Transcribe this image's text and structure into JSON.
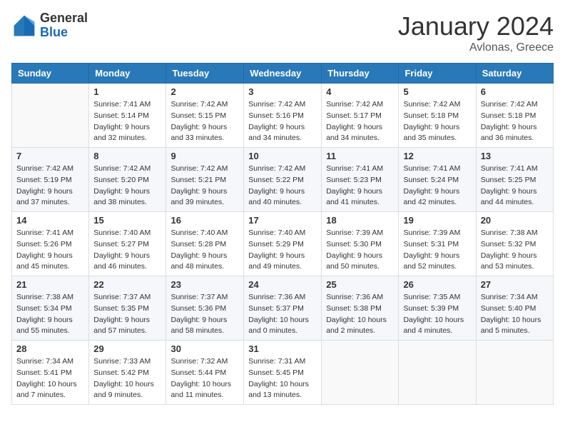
{
  "logo": {
    "general": "General",
    "blue": "Blue"
  },
  "title": "January 2024",
  "location": "Avlonas, Greece",
  "days_header": [
    "Sunday",
    "Monday",
    "Tuesday",
    "Wednesday",
    "Thursday",
    "Friday",
    "Saturday"
  ],
  "weeks": [
    [
      {
        "day": "",
        "sunrise": "",
        "sunset": "",
        "daylight": ""
      },
      {
        "day": "1",
        "sunrise": "Sunrise: 7:41 AM",
        "sunset": "Sunset: 5:14 PM",
        "daylight": "Daylight: 9 hours and 32 minutes."
      },
      {
        "day": "2",
        "sunrise": "Sunrise: 7:42 AM",
        "sunset": "Sunset: 5:15 PM",
        "daylight": "Daylight: 9 hours and 33 minutes."
      },
      {
        "day": "3",
        "sunrise": "Sunrise: 7:42 AM",
        "sunset": "Sunset: 5:16 PM",
        "daylight": "Daylight: 9 hours and 34 minutes."
      },
      {
        "day": "4",
        "sunrise": "Sunrise: 7:42 AM",
        "sunset": "Sunset: 5:17 PM",
        "daylight": "Daylight: 9 hours and 34 minutes."
      },
      {
        "day": "5",
        "sunrise": "Sunrise: 7:42 AM",
        "sunset": "Sunset: 5:18 PM",
        "daylight": "Daylight: 9 hours and 35 minutes."
      },
      {
        "day": "6",
        "sunrise": "Sunrise: 7:42 AM",
        "sunset": "Sunset: 5:18 PM",
        "daylight": "Daylight: 9 hours and 36 minutes."
      }
    ],
    [
      {
        "day": "7",
        "sunrise": "Sunrise: 7:42 AM",
        "sunset": "Sunset: 5:19 PM",
        "daylight": "Daylight: 9 hours and 37 minutes."
      },
      {
        "day": "8",
        "sunrise": "Sunrise: 7:42 AM",
        "sunset": "Sunset: 5:20 PM",
        "daylight": "Daylight: 9 hours and 38 minutes."
      },
      {
        "day": "9",
        "sunrise": "Sunrise: 7:42 AM",
        "sunset": "Sunset: 5:21 PM",
        "daylight": "Daylight: 9 hours and 39 minutes."
      },
      {
        "day": "10",
        "sunrise": "Sunrise: 7:42 AM",
        "sunset": "Sunset: 5:22 PM",
        "daylight": "Daylight: 9 hours and 40 minutes."
      },
      {
        "day": "11",
        "sunrise": "Sunrise: 7:41 AM",
        "sunset": "Sunset: 5:23 PM",
        "daylight": "Daylight: 9 hours and 41 minutes."
      },
      {
        "day": "12",
        "sunrise": "Sunrise: 7:41 AM",
        "sunset": "Sunset: 5:24 PM",
        "daylight": "Daylight: 9 hours and 42 minutes."
      },
      {
        "day": "13",
        "sunrise": "Sunrise: 7:41 AM",
        "sunset": "Sunset: 5:25 PM",
        "daylight": "Daylight: 9 hours and 44 minutes."
      }
    ],
    [
      {
        "day": "14",
        "sunrise": "Sunrise: 7:41 AM",
        "sunset": "Sunset: 5:26 PM",
        "daylight": "Daylight: 9 hours and 45 minutes."
      },
      {
        "day": "15",
        "sunrise": "Sunrise: 7:40 AM",
        "sunset": "Sunset: 5:27 PM",
        "daylight": "Daylight: 9 hours and 46 minutes."
      },
      {
        "day": "16",
        "sunrise": "Sunrise: 7:40 AM",
        "sunset": "Sunset: 5:28 PM",
        "daylight": "Daylight: 9 hours and 48 minutes."
      },
      {
        "day": "17",
        "sunrise": "Sunrise: 7:40 AM",
        "sunset": "Sunset: 5:29 PM",
        "daylight": "Daylight: 9 hours and 49 minutes."
      },
      {
        "day": "18",
        "sunrise": "Sunrise: 7:39 AM",
        "sunset": "Sunset: 5:30 PM",
        "daylight": "Daylight: 9 hours and 50 minutes."
      },
      {
        "day": "19",
        "sunrise": "Sunrise: 7:39 AM",
        "sunset": "Sunset: 5:31 PM",
        "daylight": "Daylight: 9 hours and 52 minutes."
      },
      {
        "day": "20",
        "sunrise": "Sunrise: 7:38 AM",
        "sunset": "Sunset: 5:32 PM",
        "daylight": "Daylight: 9 hours and 53 minutes."
      }
    ],
    [
      {
        "day": "21",
        "sunrise": "Sunrise: 7:38 AM",
        "sunset": "Sunset: 5:34 PM",
        "daylight": "Daylight: 9 hours and 55 minutes."
      },
      {
        "day": "22",
        "sunrise": "Sunrise: 7:37 AM",
        "sunset": "Sunset: 5:35 PM",
        "daylight": "Daylight: 9 hours and 57 minutes."
      },
      {
        "day": "23",
        "sunrise": "Sunrise: 7:37 AM",
        "sunset": "Sunset: 5:36 PM",
        "daylight": "Daylight: 9 hours and 58 minutes."
      },
      {
        "day": "24",
        "sunrise": "Sunrise: 7:36 AM",
        "sunset": "Sunset: 5:37 PM",
        "daylight": "Daylight: 10 hours and 0 minutes."
      },
      {
        "day": "25",
        "sunrise": "Sunrise: 7:36 AM",
        "sunset": "Sunset: 5:38 PM",
        "daylight": "Daylight: 10 hours and 2 minutes."
      },
      {
        "day": "26",
        "sunrise": "Sunrise: 7:35 AM",
        "sunset": "Sunset: 5:39 PM",
        "daylight": "Daylight: 10 hours and 4 minutes."
      },
      {
        "day": "27",
        "sunrise": "Sunrise: 7:34 AM",
        "sunset": "Sunset: 5:40 PM",
        "daylight": "Daylight: 10 hours and 5 minutes."
      }
    ],
    [
      {
        "day": "28",
        "sunrise": "Sunrise: 7:34 AM",
        "sunset": "Sunset: 5:41 PM",
        "daylight": "Daylight: 10 hours and 7 minutes."
      },
      {
        "day": "29",
        "sunrise": "Sunrise: 7:33 AM",
        "sunset": "Sunset: 5:42 PM",
        "daylight": "Daylight: 10 hours and 9 minutes."
      },
      {
        "day": "30",
        "sunrise": "Sunrise: 7:32 AM",
        "sunset": "Sunset: 5:44 PM",
        "daylight": "Daylight: 10 hours and 11 minutes."
      },
      {
        "day": "31",
        "sunrise": "Sunrise: 7:31 AM",
        "sunset": "Sunset: 5:45 PM",
        "daylight": "Daylight: 10 hours and 13 minutes."
      },
      {
        "day": "",
        "sunrise": "",
        "sunset": "",
        "daylight": ""
      },
      {
        "day": "",
        "sunrise": "",
        "sunset": "",
        "daylight": ""
      },
      {
        "day": "",
        "sunrise": "",
        "sunset": "",
        "daylight": ""
      }
    ]
  ]
}
